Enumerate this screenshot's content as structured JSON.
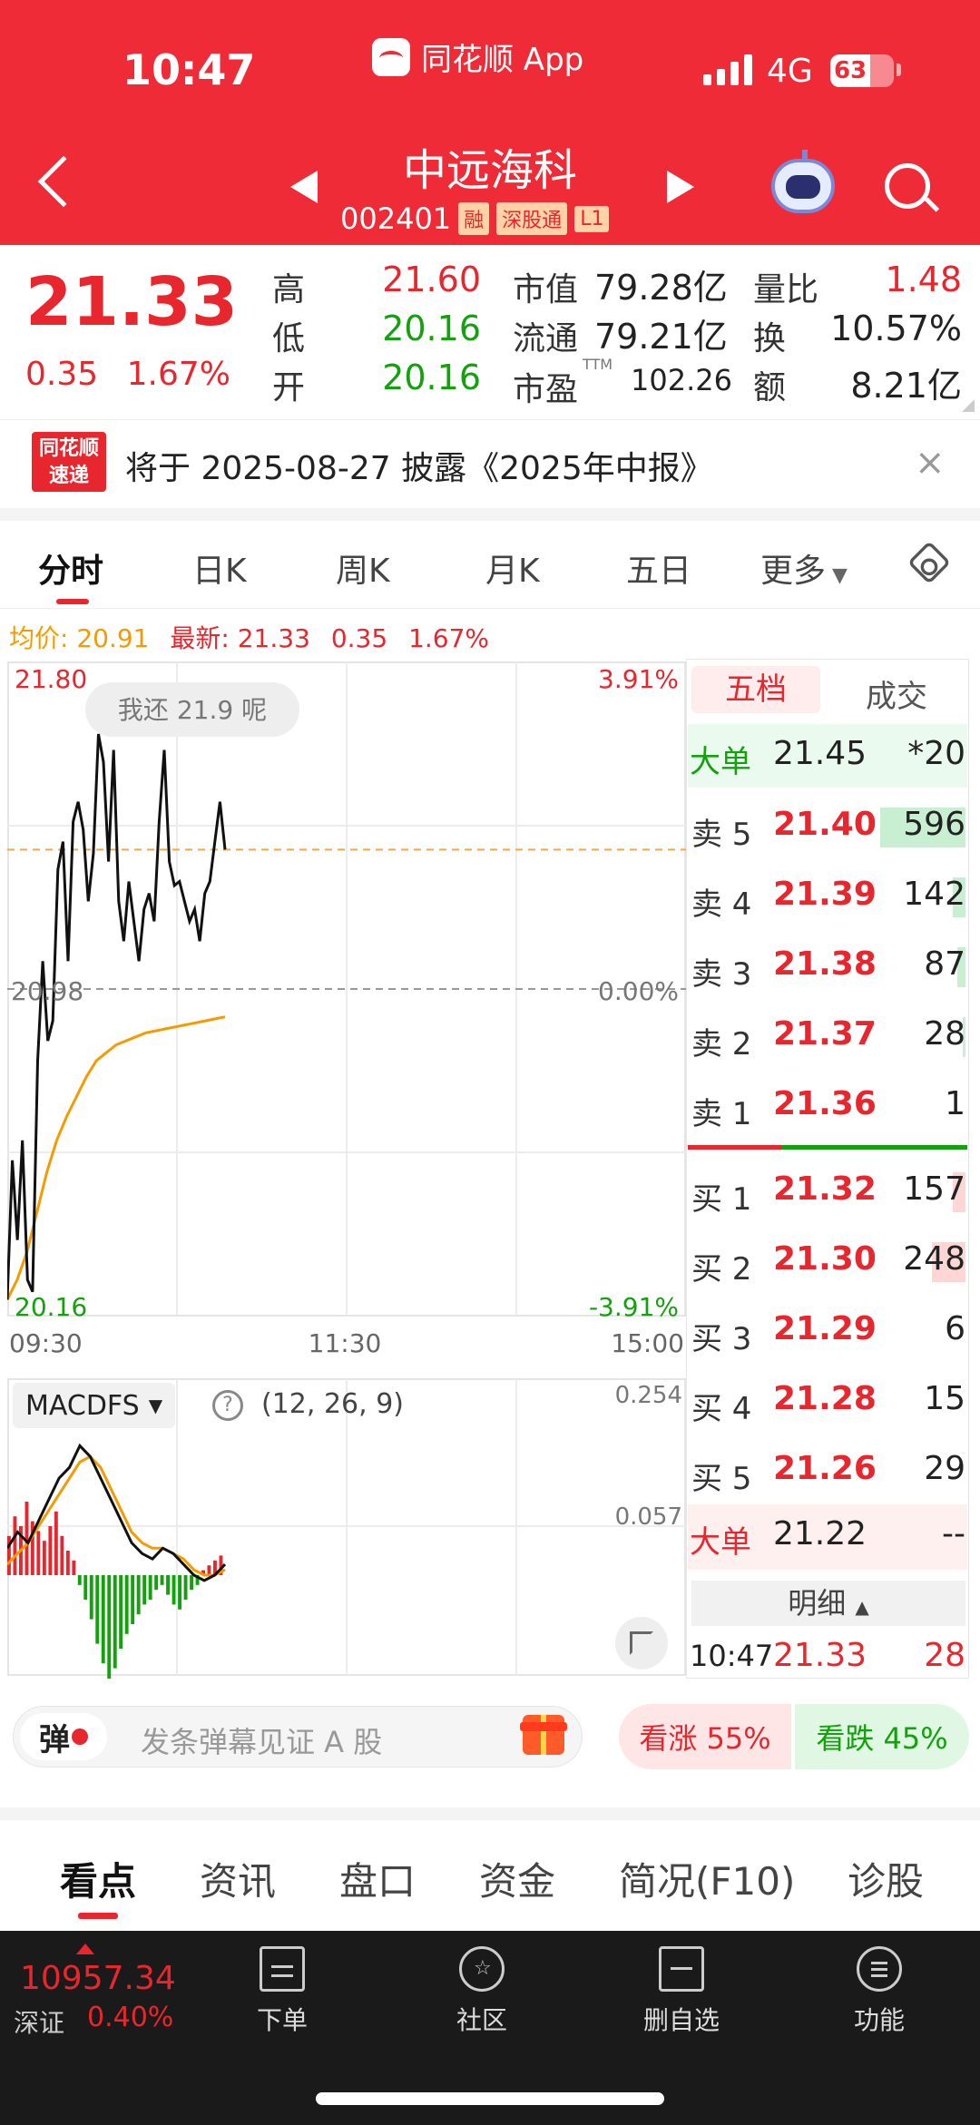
{
  "status": {
    "time": "10:47",
    "app_name": "同花顺 App",
    "network": "4G",
    "battery": "63"
  },
  "header": {
    "stock_name": "中远海科",
    "stock_code": "002401",
    "tags": [
      "融",
      "深股通",
      "L1"
    ]
  },
  "quote": {
    "price": "21.33",
    "change": "0.35",
    "change_pct": "1.67%",
    "high_label": "高",
    "high": "21.60",
    "low_label": "低",
    "low": "20.16",
    "open_label": "开",
    "open": "20.16",
    "mktcap_label": "市值",
    "mktcap": "79.28亿",
    "float_label": "流通",
    "float": "79.21亿",
    "pe_label": "市盈",
    "pe_sup": "TTM",
    "pe": "102.26",
    "vr_label": "量比",
    "vr": "1.48",
    "turn_label": "换",
    "turn": "10.57%",
    "amt_label": "额",
    "amt": "8.21亿"
  },
  "announcement": {
    "logo_line1": "同花顺",
    "logo_line2": "速递",
    "text": "将于 2025-08-27 披露《2025年中报》",
    "close": "×"
  },
  "tabs": {
    "t0": "分时",
    "t1": "日K",
    "t2": "周K",
    "t3": "月K",
    "t4": "五日",
    "t5": "更多"
  },
  "avg_bar": {
    "avg": "均价: 20.91",
    "latest": "最新: 21.33",
    "chg": "0.35",
    "pct": "1.67%"
  },
  "chart_data": {
    "type": "line",
    "title": "",
    "y_top": "21.80",
    "y_mid": "20.98",
    "y_bottom": "20.16",
    "pct_top": "3.91%",
    "pct_mid": "0.00%",
    "pct_bottom": "-3.91%",
    "x_labels": [
      "09:30",
      "11:30",
      "15:00"
    ],
    "ylim": [
      20.16,
      21.8
    ],
    "bubble": "我还 21.9 呢",
    "series": [
      {
        "values": [
          20.2,
          20.55,
          20.35,
          20.6,
          20.25,
          20.22,
          20.8,
          21.05,
          20.85,
          20.9,
          21.28,
          21.35,
          21.05,
          21.4,
          21.45,
          21.38,
          21.2,
          21.32,
          21.62,
          21.55,
          21.3,
          21.58,
          21.2,
          21.1,
          21.25,
          21.15,
          21.05,
          21.18,
          21.22,
          21.15,
          21.4,
          21.58,
          21.3,
          21.24,
          21.25,
          21.2,
          21.15,
          21.18,
          21.1,
          21.22,
          21.25,
          21.35,
          21.45,
          21.33
        ]
      },
      {
        "values": [
          20.2,
          20.25,
          20.32,
          20.42,
          20.52,
          20.6,
          20.66,
          20.71,
          20.76,
          20.8,
          20.82,
          20.84,
          20.85,
          20.86,
          20.87,
          20.875,
          20.88,
          20.885,
          20.89,
          20.895,
          20.9,
          20.905,
          20.91
        ]
      }
    ]
  },
  "macd": {
    "name": "MACDFS",
    "params": "(12, 26, 9)",
    "y_top": "0.254",
    "y_mid": "0.057",
    "hist": [
      0.08,
      0.12,
      0.1,
      0.15,
      0.11,
      0.09,
      0.07,
      0.1,
      0.13,
      0.08,
      0.05,
      0.03,
      -0.02,
      -0.05,
      -0.09,
      -0.14,
      -0.18,
      -0.22,
      -0.19,
      -0.15,
      -0.12,
      -0.1,
      -0.08,
      -0.06,
      -0.05,
      -0.03,
      -0.02,
      -0.04,
      -0.06,
      -0.07,
      -0.05,
      -0.03,
      -0.02,
      0.01,
      0.02,
      0.03,
      0.04
    ],
    "dif": [
      0.05,
      0.08,
      0.06,
      0.1,
      0.14,
      0.18,
      0.2,
      0.24,
      0.22,
      0.18,
      0.14,
      0.1,
      0.06,
      0.04,
      0.03,
      0.05,
      0.04,
      0.02,
      0.0,
      -0.01,
      0.0,
      0.02
    ],
    "dea": [
      0.02,
      0.04,
      0.06,
      0.09,
      0.12,
      0.15,
      0.18,
      0.21,
      0.22,
      0.2,
      0.16,
      0.12,
      0.08,
      0.06,
      0.05,
      0.05,
      0.04,
      0.03,
      0.01,
      0.0,
      0.0,
      0.01
    ]
  },
  "orderbook": {
    "tab_active": "五档",
    "tab_other": "成交",
    "big_top": {
      "label": "大单",
      "price": "21.45",
      "vol": "*20"
    },
    "asks": [
      {
        "label": "卖 5",
        "price": "21.40",
        "vol": "596",
        "bar": 0.55
      },
      {
        "label": "卖 4",
        "price": "21.39",
        "vol": "142",
        "bar": 0.08
      },
      {
        "label": "卖 3",
        "price": "21.38",
        "vol": "87",
        "bar": 0.05
      },
      {
        "label": "卖 2",
        "price": "21.37",
        "vol": "28",
        "bar": 0.02
      },
      {
        "label": "卖 1",
        "price": "21.36",
        "vol": "1",
        "bar": 0
      }
    ],
    "bids": [
      {
        "label": "买 1",
        "price": "21.32",
        "vol": "157",
        "bar": 0.08
      },
      {
        "label": "买 2",
        "price": "21.30",
        "vol": "248",
        "bar": 0.22
      },
      {
        "label": "买 3",
        "price": "21.29",
        "vol": "6",
        "bar": 0
      },
      {
        "label": "买 4",
        "price": "21.28",
        "vol": "15",
        "bar": 0
      },
      {
        "label": "买 5",
        "price": "21.26",
        "vol": "29",
        "bar": 0
      }
    ],
    "big_bottom": {
      "label": "大单",
      "price": "21.22",
      "vol": "--"
    },
    "detail_label": "明细",
    "tick": {
      "time": "10:47",
      "price": "21.33",
      "vol": "28"
    }
  },
  "danmaku": {
    "badge": "弹",
    "placeholder": "发条弹幕见证 A 股",
    "up": "看涨 55%",
    "down": "看跌 45%"
  },
  "bottom_tabs": {
    "b0": "看点",
    "b1": "资讯",
    "b2": "盘口",
    "b3": "资金",
    "b4": "简况(F10)",
    "b5": "诊股"
  },
  "index": {
    "value": "10957.34",
    "name": "深证",
    "pct": "0.40%"
  },
  "nav": {
    "n0": "下单",
    "n1": "社区",
    "n2": "删自选",
    "n3": "功能"
  },
  "colors": {
    "up": "#e8262d",
    "down": "#13a10e",
    "brand": "#ee2b36"
  }
}
